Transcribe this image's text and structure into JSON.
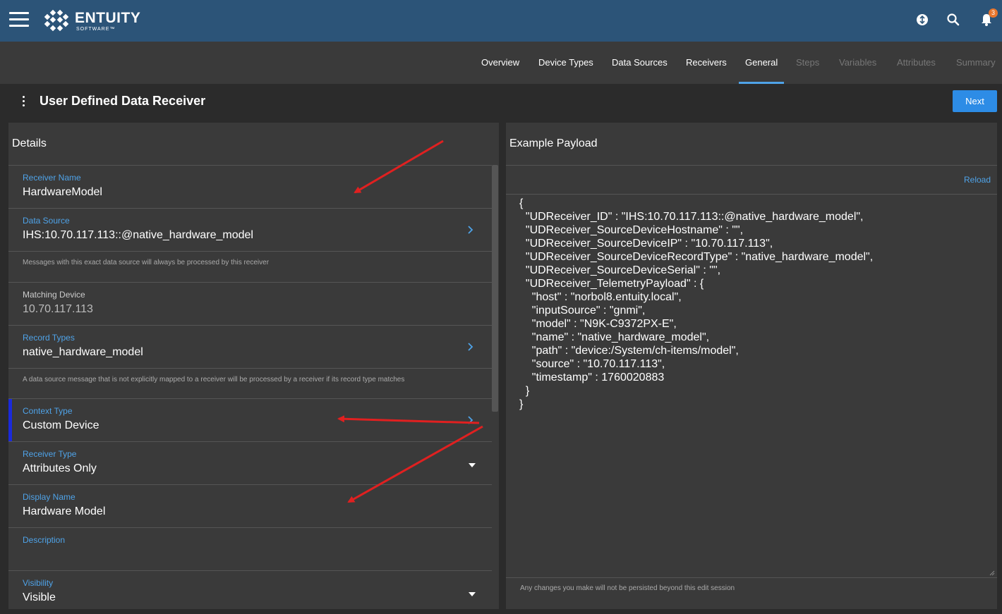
{
  "header": {
    "brand": "ENTUITY",
    "brand_sub": "SOFTWARE™",
    "notification_count": "3"
  },
  "tabs": [
    {
      "label": "Overview",
      "state": "enabled"
    },
    {
      "label": "Device Types",
      "state": "enabled"
    },
    {
      "label": "Data Sources",
      "state": "enabled"
    },
    {
      "label": "Receivers",
      "state": "enabled"
    },
    {
      "label": "General",
      "state": "active"
    },
    {
      "label": "Steps",
      "state": "disabled"
    },
    {
      "label": "Variables",
      "state": "disabled"
    },
    {
      "label": "Attributes",
      "state": "disabled"
    },
    {
      "label": "Summary",
      "state": "disabled"
    }
  ],
  "page": {
    "title": "User Defined Data Receiver",
    "next_label": "Next"
  },
  "details": {
    "title": "Details",
    "fields": {
      "receiver_name": {
        "label": "Receiver Name",
        "value": "HardwareModel"
      },
      "data_source": {
        "label": "Data Source",
        "value": "IHS:10.70.117.113::@native_hardware_model",
        "hint": "Messages with this exact data source will always be processed by this receiver"
      },
      "matching_device": {
        "label": "Matching Device",
        "value": "10.70.117.113"
      },
      "record_types": {
        "label": "Record Types",
        "value": "native_hardware_model",
        "hint": "A data source message that is not explicitly mapped to a receiver will be processed by a receiver if its record type matches"
      },
      "context_type": {
        "label": "Context Type",
        "value": "Custom Device"
      },
      "receiver_type": {
        "label": "Receiver Type",
        "value": "Attributes Only"
      },
      "display_name": {
        "label": "Display Name",
        "value": "Hardware Model"
      },
      "description": {
        "label": "Description",
        "value": ""
      },
      "visibility": {
        "label": "Visibility",
        "value": "Visible"
      }
    }
  },
  "payload": {
    "title": "Example Payload",
    "reload_label": "Reload",
    "content": "{\n  \"UDReceiver_ID\" : \"IHS:10.70.117.113::@native_hardware_model\",\n  \"UDReceiver_SourceDeviceHostname\" : \"\",\n  \"UDReceiver_SourceDeviceIP\" : \"10.70.117.113\",\n  \"UDReceiver_SourceDeviceRecordType\" : \"native_hardware_model\",\n  \"UDReceiver_SourceDeviceSerial\" : \"\",\n  \"UDReceiver_TelemetryPayload\" : {\n    \"host\" : \"norbol8.entuity.local\",\n    \"inputSource\" : \"gnmi\",\n    \"model\" : \"N9K-C9372PX-E\",\n    \"name\" : \"native_hardware_model\",\n    \"path\" : \"device:/System/ch-items/model\",\n    \"source\" : \"10.70.117.113\",\n    \"timestamp\" : 1760020883\n  }\n}",
    "footnote": "Any changes you make will not be persisted beyond this edit session"
  },
  "colors": {
    "topbar": "#2c5478",
    "accent": "#4fa3e8",
    "button": "#2d8ce6",
    "annotation_arrow": "#e02020"
  }
}
